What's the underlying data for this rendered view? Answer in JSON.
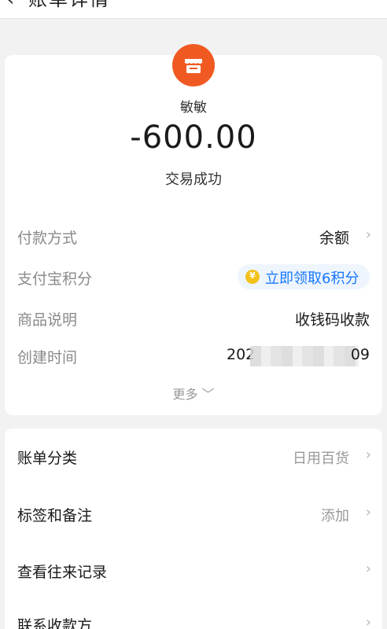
{
  "nav": {
    "back_icon": "chevron-left",
    "title": "账单详情"
  },
  "merchant": {
    "avatar_icon": "store-icon",
    "avatar_color": "#f05a22",
    "name": "敏敏"
  },
  "amount": "-600.00",
  "status": "交易成功",
  "details": {
    "payment_method": {
      "label": "付款方式",
      "value": "余额"
    },
    "points": {
      "label": "支付宝积分",
      "coin_symbol": "¥",
      "action": "立即领取6积分",
      "action_color": "#1677ff"
    },
    "product": {
      "label": "商品说明",
      "value": "收钱码收款"
    },
    "created": {
      "label": "创建时间",
      "value_start": "202",
      "value_end": "09"
    },
    "more": "更多"
  },
  "actions": [
    {
      "label": "账单分类",
      "value": "日用百货"
    },
    {
      "label": "标签和备注",
      "value": "添加"
    },
    {
      "label": "查看往来记录",
      "value": ""
    },
    {
      "label": "联系收款方",
      "value": ""
    }
  ]
}
